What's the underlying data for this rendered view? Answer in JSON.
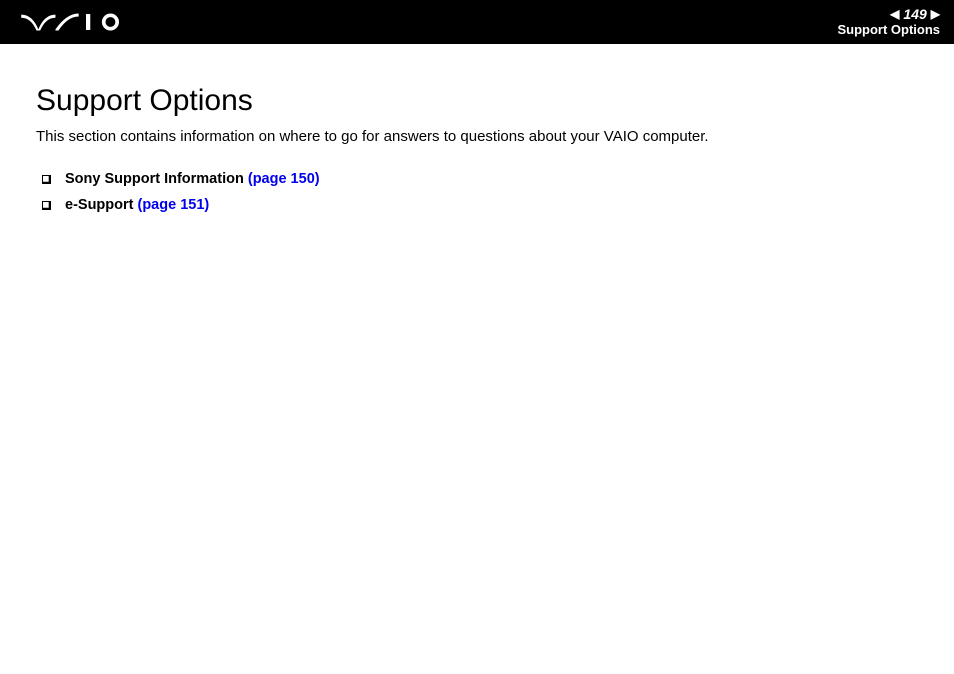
{
  "header": {
    "page_number": "149",
    "section": "Support Options"
  },
  "main": {
    "title": "Support Options",
    "intro": "This section contains information on where to go for answers to questions about your VAIO computer.",
    "toc": [
      {
        "label": "Sony Support Information",
        "page_ref": "(page 150)"
      },
      {
        "label": "e-Support",
        "page_ref": "(page 151)"
      }
    ]
  }
}
